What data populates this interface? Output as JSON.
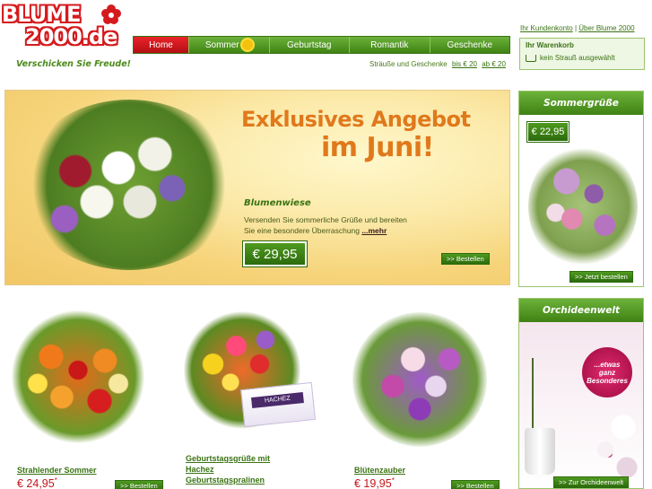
{
  "brand": {
    "line1": "BLUME",
    "line2": "2000.de",
    "tagline": "Verschicken Sie Freude!"
  },
  "nav": {
    "home": "Home",
    "summer": "Sommer",
    "birthday": "Geburtstag",
    "romance": "Romantik",
    "gifts": "Geschenke"
  },
  "subnav": {
    "label": "Sträuße und Geschenke",
    "link1": "bis € 20",
    "link2": "ab € 20"
  },
  "toplinks": {
    "account": "Ihr Kundenkonto",
    "separator": "|",
    "about": "Über Blume 2000"
  },
  "cart": {
    "title": "Ihr Warenkorb",
    "status": "kein Strauß ausgewählt"
  },
  "hero": {
    "headline_line1": "Exklusives Angebot",
    "headline_line2": "im Juni!",
    "product_title": "Blumenwiese",
    "text_line1": "Versenden Sie sommerliche Grüße und bereiten",
    "text_line2": "Sie eine besondere Überraschung",
    "more_link": "...mehr",
    "price": "€ 29,95",
    "button": ">> Bestellen"
  },
  "promo_summer": {
    "title": "Sommergrüße",
    "price": "€ 22,95",
    "button": ">> Jetzt bestellen"
  },
  "promo_orchid": {
    "title": "Orchideenwelt",
    "bubble_line1": "...etwas",
    "bubble_line2": "ganz",
    "bubble_line3": "Besonderes",
    "button": ">> Zur Orchideenwelt"
  },
  "products": [
    {
      "name": "Strahlender Sommer",
      "price": "€ 24,95",
      "asterisk": "*",
      "button": ">> Bestellen"
    },
    {
      "name_line1": "Geburtstagsgrüße mit",
      "name_line2": "Hachez",
      "name_line3": "Geburtstagspralinen",
      "box_label": "HACHEZ"
    },
    {
      "name": "Blütenzauber",
      "price": "€ 19,95",
      "asterisk": "*",
      "button": ">> Bestellen"
    }
  ],
  "colors": {
    "brand_red": "#d51a1e",
    "brand_green": "#3f8214",
    "accent_orange": "#e0791c",
    "price_red": "#c3151b"
  }
}
